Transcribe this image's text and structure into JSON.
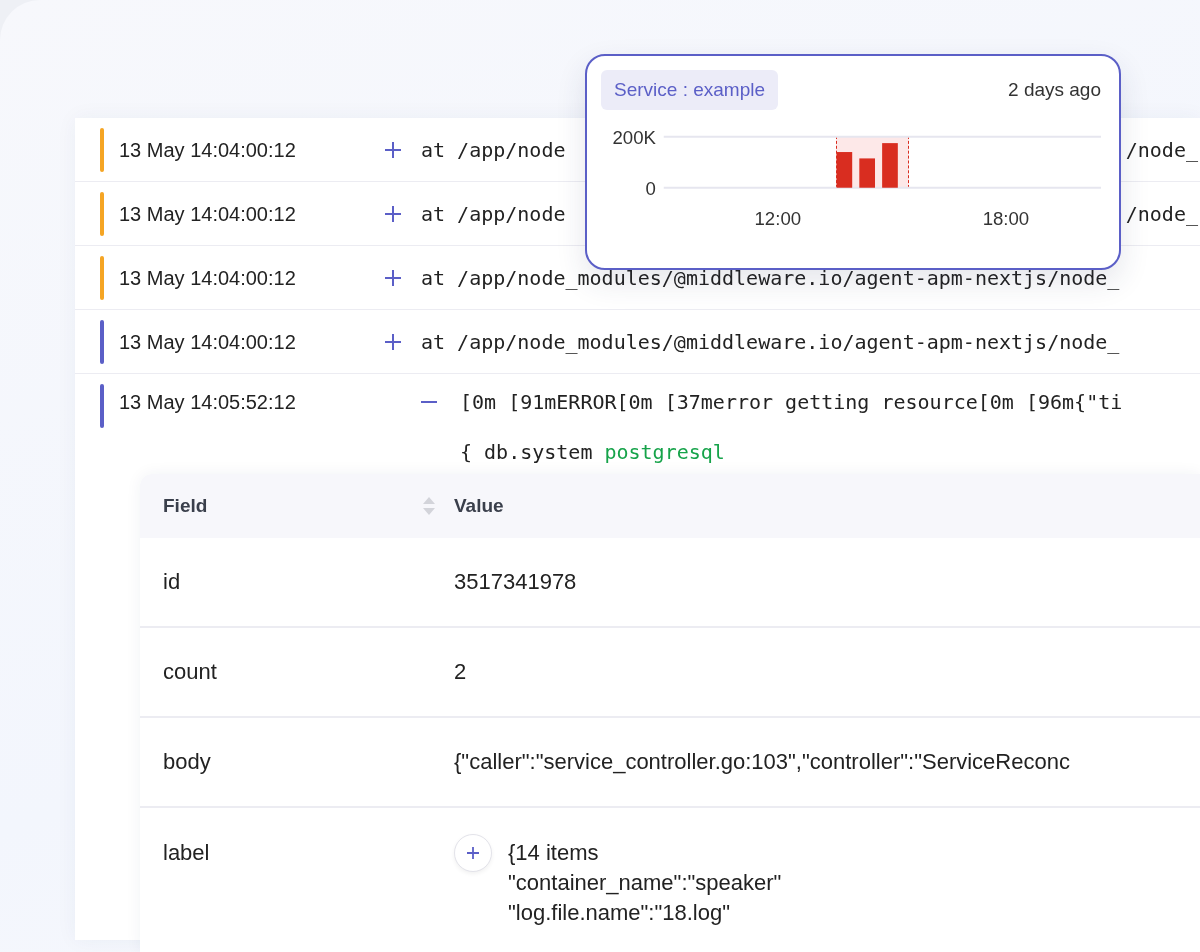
{
  "logs": [
    {
      "time": "13 May 14:04:00:12",
      "color": "#f5a524",
      "expanded": false,
      "message": "at /app/node",
      "message_tail": "/node_"
    },
    {
      "time": "13 May 14:04:00:12",
      "color": "#f5a524",
      "expanded": false,
      "message": "at /app/node",
      "message_tail": "/node_"
    },
    {
      "time": "13 May 14:04:00:12",
      "color": "#f5a524",
      "expanded": false,
      "message": "at /app/node_modules/@middleware.io/agent-apm-nextjs/node_"
    },
    {
      "time": "13 May 14:04:00:12",
      "color": "#5b5fc7",
      "expanded": false,
      "message": "at /app/node_modules/@middleware.io/agent-apm-nextjs/node_"
    },
    {
      "time": "13 May 14:05:52:12",
      "color": "#5b5fc7",
      "expanded": true,
      "message": "[0m [91mERROR[0m [37merror getting resource[0m [96m{\"ti",
      "detail_key": "{ db.system",
      "detail_value": "postgresql"
    }
  ],
  "popup": {
    "tag": "Service : example",
    "time": "2 days ago",
    "chart_data": {
      "type": "bar",
      "x": [
        13.75,
        14.35,
        14.95
      ],
      "series": [
        {
          "color": "#d92d20",
          "values": [
            140000,
            115000,
            175000
          ]
        }
      ],
      "xlim": [
        9,
        20.5
      ],
      "ylim": [
        0,
        200000
      ],
      "xticks": [
        {
          "value": 12,
          "label": "12:00"
        },
        {
          "value": 18,
          "label": "18:00"
        }
      ],
      "yticks": [
        {
          "value": 0,
          "label": "0"
        },
        {
          "value": 200000,
          "label": "200K"
        }
      ]
    }
  },
  "table": {
    "columns": [
      "Field",
      "Value"
    ],
    "rows": [
      {
        "field": "id",
        "value": [
          "3517341978"
        ]
      },
      {
        "field": "count",
        "value": [
          "2"
        ]
      },
      {
        "field": "body",
        "value": [
          "{\"caller\":\"service_controller.go:103\",\"controller\":\"ServiceReconc"
        ]
      },
      {
        "field": "label",
        "expandable": true,
        "value": [
          "{14 items",
          "\"container_name\":\"speaker\"",
          "\"log.file.name\":\"18.log\""
        ]
      }
    ]
  }
}
